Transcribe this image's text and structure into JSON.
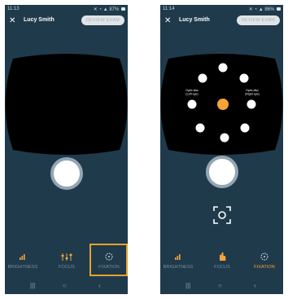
{
  "colors": {
    "app_background": "#1f3a4b",
    "active_accent": "#f4a43a",
    "highlight_box": "#e9a02e",
    "fixation_dot": "#f4a43a"
  },
  "left_screen": {
    "status": {
      "time": "11:13",
      "battery": "87%"
    },
    "header": {
      "close_icon": "close-icon",
      "patient_name": "Lucy Smith",
      "review_button": "REVIEW EXAM"
    },
    "toolbar": {
      "brightness_label": "BRIGHTNESS",
      "focus_label": "FOCUS",
      "fixation_label": "FIXATION",
      "highlighted_tool": "fixation"
    },
    "nav": {
      "recents_icon": "recents-icon",
      "home_icon": "home-icon",
      "back_icon": "back-icon"
    }
  },
  "right_screen": {
    "status": {
      "time": "11:14",
      "battery": "86%"
    },
    "header": {
      "close_icon": "close-icon",
      "patient_name": "Lucy Smith",
      "review_button": "REVIEW EXAM"
    },
    "field": {
      "left_eye_label_line1": "Optic disc",
      "left_eye_label_line2": "(Left eye)",
      "right_eye_label_line1": "Optic disc",
      "right_eye_label_line2": "(Right eye)"
    },
    "toolbar": {
      "brightness_label": "BRIGHTNESS",
      "focus_label": "FOCUS",
      "fixation_label": "FIXATION",
      "active_tool": "fixation"
    },
    "nav": {
      "recents_icon": "recents-icon",
      "home_icon": "home-icon",
      "back_icon": "back-icon"
    }
  }
}
